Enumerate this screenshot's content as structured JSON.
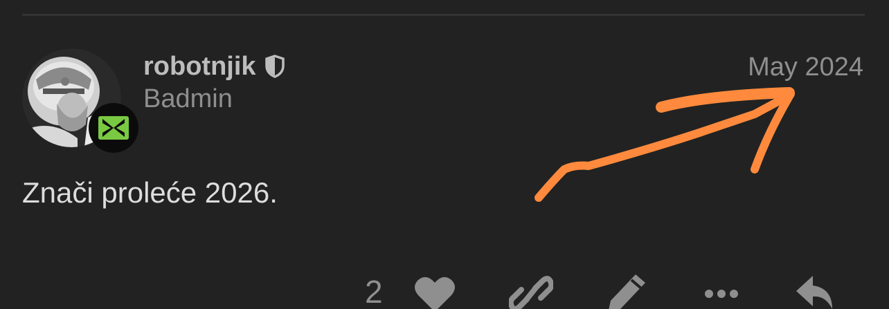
{
  "post": {
    "username": "robotnjik",
    "user_title": "Badmin",
    "date": "May 2024",
    "body": "Znači proleće 2026.",
    "like_count": "2"
  },
  "icons": {
    "moderator": "shield-icon",
    "flair": "flair-logo-icon",
    "like": "heart-icon",
    "link": "link-icon",
    "edit": "pencil-icon",
    "more": "ellipsis-icon",
    "reply": "reply-icon"
  },
  "colors": {
    "background": "#222222",
    "annotation_arrow": "#ff8a3d",
    "flair_green": "#7ac943"
  }
}
